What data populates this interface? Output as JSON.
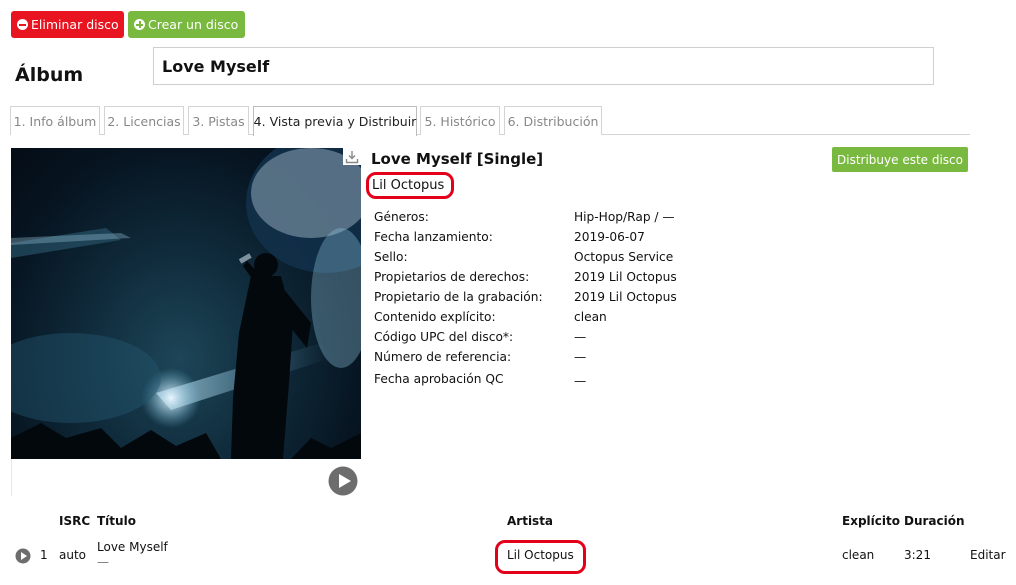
{
  "toolbar": {
    "delete_label": "Eliminar disco",
    "create_label": "Crear un disco"
  },
  "page": {
    "heading": "Álbum",
    "album_input_value": "Love Myself"
  },
  "tabs": [
    {
      "label": "1. Info álbum"
    },
    {
      "label": "2. Licencias"
    },
    {
      "label": "3. Pistas"
    },
    {
      "label": "4. Vista previa y Distribuir",
      "active": true
    },
    {
      "label": "5. Histórico"
    },
    {
      "label": "6. Distribución"
    }
  ],
  "preview": {
    "title": "Love Myself [Single]",
    "artist": "Lil Octopus",
    "distribute_label": "Distribuye este disco",
    "fields": [
      {
        "label": "Géneros:",
        "value": "Hip-Hop/Rap / —"
      },
      {
        "label": "Fecha lanzamiento:",
        "value": "2019-06-07"
      },
      {
        "label": "Sello:",
        "value": "Octopus Service"
      },
      {
        "label": "Propietarios de derechos:",
        "value": "2019 Lil Octopus"
      },
      {
        "label": "Propietario de la grabación:",
        "value": "2019 Lil Octopus"
      },
      {
        "label": "Contenido explícito:",
        "value": "clean"
      },
      {
        "label": "Código UPC del disco*:",
        "value": "—"
      },
      {
        "label": "Número de referencia:",
        "value": "—"
      },
      {
        "label": "Fecha aprobación QC",
        "value": "—"
      }
    ]
  },
  "tracks": {
    "headers": {
      "isrc": "ISRC",
      "title": "Título",
      "artist": "Artista",
      "explicit": "Explícito",
      "duration": "Duración"
    },
    "rows": [
      {
        "number": "1",
        "isrc": "auto",
        "title": "Love Myself",
        "subtitle": "—",
        "artist": "Lil Octopus",
        "explicit": "clean",
        "duration": "3:21",
        "edit": "Editar"
      }
    ]
  },
  "colors": {
    "danger": "#e8141f",
    "success": "#7ab93f",
    "highlight": "#e4001b"
  },
  "icons": [
    "minus-circle-icon",
    "plus-circle-icon",
    "download-icon",
    "play-icon"
  ]
}
